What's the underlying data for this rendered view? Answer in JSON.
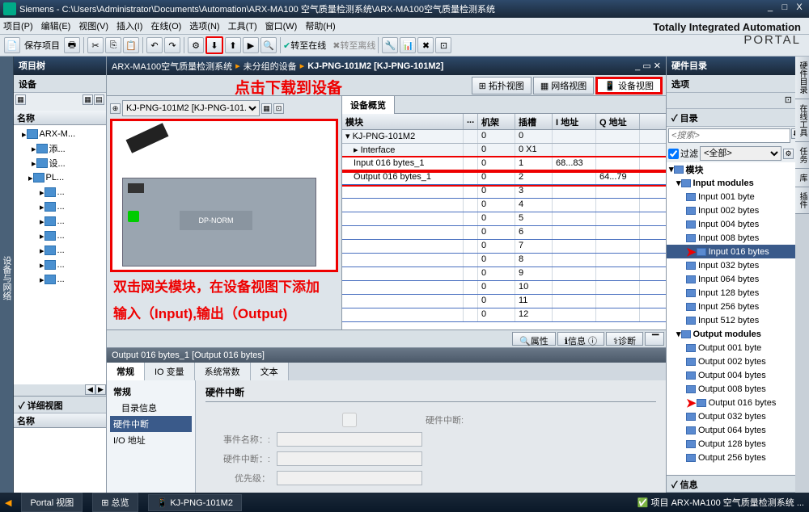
{
  "title": "Siemens  -  C:\\Users\\Administrator\\Documents\\Automation\\ARX-MA100 空气质量检测系统\\ARX-MA100空气质量检测系统",
  "menu": [
    "项目(P)",
    "编辑(E)",
    "视图(V)",
    "插入(I)",
    "在线(O)",
    "选项(N)",
    "工具(T)",
    "窗口(W)",
    "帮助(H)"
  ],
  "toolbar": {
    "save": "保存项目",
    "goonline": "转至在线",
    "gooffline": "转至离线"
  },
  "brand": {
    "main": "Totally Integrated Automation",
    "sub": "PORTAL"
  },
  "sidetab_left": "设备与网络",
  "projtree": {
    "hdr": "项目树",
    "sub": "设备",
    "colhdr": "名称",
    "items": [
      {
        "ind": 6,
        "label": "ARX-M..."
      },
      {
        "ind": 18,
        "label": "添..."
      },
      {
        "ind": 18,
        "label": "设..."
      },
      {
        "ind": 14,
        "label": "PL..."
      },
      {
        "ind": 28,
        "label": "..."
      },
      {
        "ind": 28,
        "label": "..."
      },
      {
        "ind": 28,
        "label": "..."
      },
      {
        "ind": 28,
        "label": "..."
      },
      {
        "ind": 28,
        "label": "..."
      },
      {
        "ind": 28,
        "label": "..."
      },
      {
        "ind": 28,
        "label": "..."
      }
    ],
    "detail": "详细视图",
    "detailcol": "名称"
  },
  "breadcrumb": [
    "ARX-MA100空气质量检测系统",
    "未分组的设备",
    "KJ-PNG-101M2 [KJ-PNG-101M2]"
  ],
  "viewtabs": {
    "topo": "拓扑视图",
    "net": "网络视图",
    "dev": "设备视图"
  },
  "device_selector": "KJ-PNG-101M2 [KJ-PNG-101...",
  "dpnorm": "DP-NORM",
  "annot1": "点击下载到设备",
  "annot2a": "双击网关模块，在设备视图下添加",
  "annot2b": "输入（Input),输出（Output)",
  "overview": {
    "tab": "设备概览",
    "cols": {
      "mod": "模块",
      "rack": "机架",
      "slot": "插槽",
      "iaddr": "I 地址",
      "qaddr": "Q 地址"
    },
    "rows": [
      {
        "mod": "KJ-PNG-101M2",
        "rack": "0",
        "slot": "0",
        "i": "",
        "q": "",
        "hdr": true
      },
      {
        "mod": "▸ Interface",
        "rack": "0",
        "slot": "0 X1",
        "i": "",
        "q": "",
        "hdr": true,
        "ind": 10
      },
      {
        "mod": "Input 016 bytes_1",
        "rack": "0",
        "slot": "1",
        "i": "68...83",
        "q": "",
        "hl": true,
        "ind": 10
      },
      {
        "mod": "Output 016 bytes_1",
        "rack": "0",
        "slot": "2",
        "i": "",
        "q": "64...79",
        "hl": true,
        "ind": 10
      },
      {
        "mod": "",
        "rack": "0",
        "slot": "3",
        "i": "",
        "q": ""
      },
      {
        "mod": "",
        "rack": "0",
        "slot": "4",
        "i": "",
        "q": ""
      },
      {
        "mod": "",
        "rack": "0",
        "slot": "5",
        "i": "",
        "q": ""
      },
      {
        "mod": "",
        "rack": "0",
        "slot": "6",
        "i": "",
        "q": ""
      },
      {
        "mod": "",
        "rack": "0",
        "slot": "7",
        "i": "",
        "q": ""
      },
      {
        "mod": "",
        "rack": "0",
        "slot": "8",
        "i": "",
        "q": ""
      },
      {
        "mod": "",
        "rack": "0",
        "slot": "9",
        "i": "",
        "q": ""
      },
      {
        "mod": "",
        "rack": "0",
        "slot": "10",
        "i": "",
        "q": ""
      },
      {
        "mod": "",
        "rack": "0",
        "slot": "11",
        "i": "",
        "q": ""
      },
      {
        "mod": "",
        "rack": "0",
        "slot": "12",
        "i": "",
        "q": ""
      }
    ]
  },
  "infotabs": {
    "prop": "属性",
    "info": "信息",
    "diag": "诊断"
  },
  "prop": {
    "bc": "Output 016 bytes_1 [Output 016 bytes]",
    "tabs": [
      "常规",
      "IO 变量",
      "系统常数",
      "文本"
    ],
    "nav": [
      "常规",
      "目录信息",
      "硬件中断",
      "I/O 地址"
    ],
    "navsel": 2,
    "title": "硬件中断",
    "fields": {
      "cb": "硬件中断:",
      "ev": "事件名称：:",
      "hi": "硬件中断：:",
      "pr": "优先级："
    }
  },
  "catalog": {
    "hdr": "硬件目录",
    "opt": "选项",
    "dir": "目录",
    "search": "<搜索>",
    "filter": "过滤",
    "filterval": "<全部>",
    "items": [
      {
        "label": "模块",
        "grp": true,
        "ind": 3
      },
      {
        "label": "Input modules",
        "grp": true,
        "ind": 12
      },
      {
        "label": "Input 001 byte",
        "ind": 24
      },
      {
        "label": "Input 002 bytes",
        "ind": 24
      },
      {
        "label": "Input 004 bytes",
        "ind": 24
      },
      {
        "label": "Input 008 bytes",
        "ind": 24
      },
      {
        "label": "Input 016 bytes",
        "ind": 24,
        "sel": true,
        "arrow": true
      },
      {
        "label": "Input 032 bytes",
        "ind": 24
      },
      {
        "label": "Input 064 bytes",
        "ind": 24
      },
      {
        "label": "Input 128 bytes",
        "ind": 24
      },
      {
        "label": "Input 256 bytes",
        "ind": 24
      },
      {
        "label": "Input 512 bytes",
        "ind": 24
      },
      {
        "label": "Output modules",
        "grp": true,
        "ind": 12
      },
      {
        "label": "Output 001 byte",
        "ind": 24
      },
      {
        "label": "Output 002 bytes",
        "ind": 24
      },
      {
        "label": "Output 004 bytes",
        "ind": 24
      },
      {
        "label": "Output 008 bytes",
        "ind": 24
      },
      {
        "label": "Output 016 bytes",
        "ind": 24,
        "arrow": true
      },
      {
        "label": "Output 032 bytes",
        "ind": 24
      },
      {
        "label": "Output 064 bytes",
        "ind": 24
      },
      {
        "label": "Output 128 bytes",
        "ind": 24
      },
      {
        "label": "Output 256 bytes",
        "ind": 24
      }
    ],
    "info": "信息"
  },
  "rtabs": [
    "硬件目录",
    "在线工具",
    "任务",
    "库",
    "插件"
  ],
  "status": {
    "portal": "Portal 视图",
    "overview": "总览",
    "dev": "KJ-PNG-101M2",
    "proj": "项目 ARX-MA100 空气质量检测系统 ..."
  }
}
